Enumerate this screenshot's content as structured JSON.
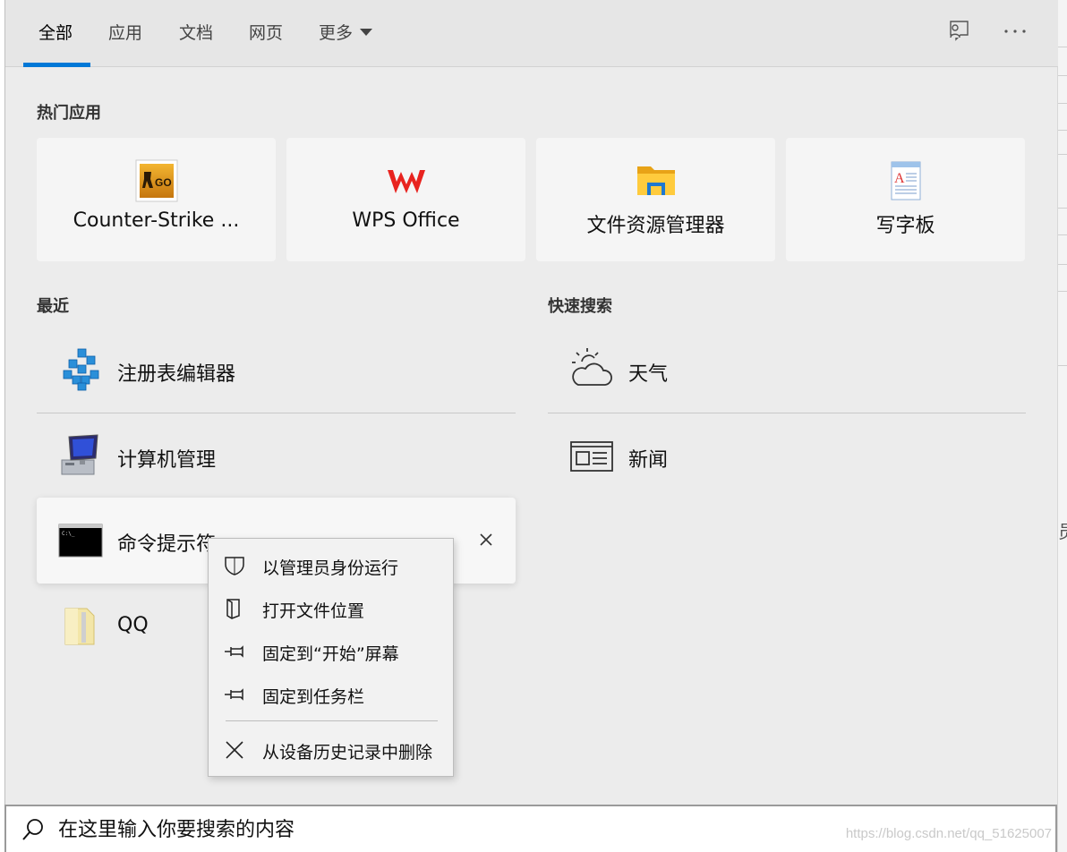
{
  "tabs": [
    {
      "label": "全部",
      "active": true
    },
    {
      "label": "应用",
      "active": false
    },
    {
      "label": "文档",
      "active": false
    },
    {
      "label": "网页",
      "active": false
    },
    {
      "label": "更多",
      "active": false,
      "dropdown": true
    }
  ],
  "accent_color": "#0078d7",
  "top_apps": {
    "title": "热门应用",
    "items": [
      {
        "label": "Counter-Strike ...",
        "icon": "csgo-icon"
      },
      {
        "label": "WPS Office",
        "icon": "wps-icon"
      },
      {
        "label": "文件资源管理器",
        "icon": "folder-icon"
      },
      {
        "label": "写字板",
        "icon": "wordpad-icon"
      }
    ]
  },
  "recent": {
    "title": "最近",
    "items": [
      {
        "label": "注册表编辑器",
        "icon": "registry-icon"
      },
      {
        "label": "计算机管理",
        "icon": "computer-management-icon"
      },
      {
        "label": "命令提示符",
        "icon": "cmd-icon"
      },
      {
        "label": "QQ",
        "icon": "folder-zip-icon"
      }
    ]
  },
  "quick_search": {
    "title": "快速搜索",
    "items": [
      {
        "label": "天气",
        "icon": "weather-icon"
      },
      {
        "label": "新闻",
        "icon": "news-icon"
      }
    ]
  },
  "context_menu": {
    "items": [
      {
        "label": "以管理员身份运行",
        "icon": "shield-icon"
      },
      {
        "label": "打开文件位置",
        "icon": "file-location-icon"
      },
      {
        "label": "固定到“开始”屏幕",
        "icon": "pin-icon"
      },
      {
        "label": "固定到任务栏",
        "icon": "pin-icon"
      },
      {
        "label": "从设备历史记录中删除",
        "icon": "close-icon"
      }
    ]
  },
  "search": {
    "placeholder": "在这里输入你要搜索的内容"
  },
  "watermark": "https://blog.csdn.net/qq_51625007",
  "background_char": "员"
}
